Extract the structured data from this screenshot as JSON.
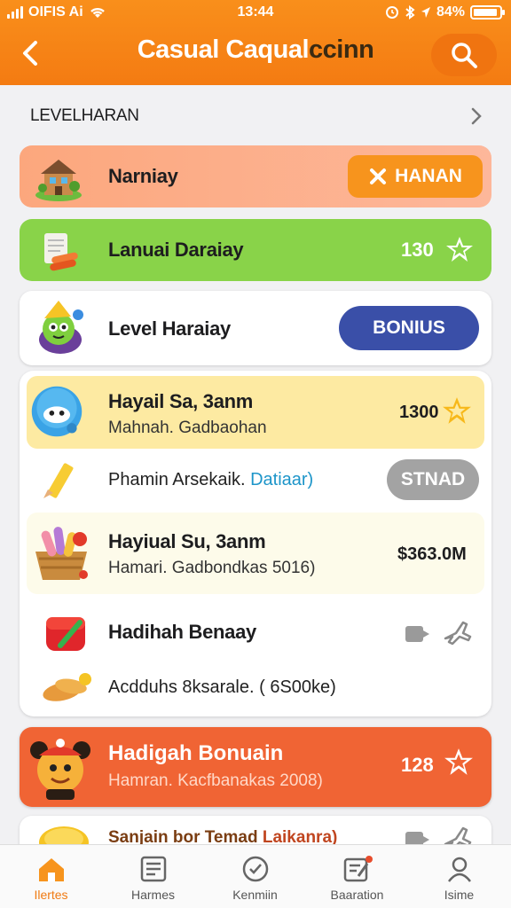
{
  "status_bar": {
    "carrier": "OIFIS Ai",
    "time": "13:44",
    "battery": "84%"
  },
  "header": {
    "title_main": "Casual Caqual",
    "title_tail": "ccinn"
  },
  "level_header": {
    "title": "LEVELHARAN",
    "title_accent": ""
  },
  "cards": [
    {
      "label": "Narniay",
      "button_label": "HANAN",
      "color": "#fca880"
    },
    {
      "label": "Lanuai Daraiay",
      "score": "130",
      "color": "#89d349"
    },
    {
      "label": "Level Haraiay",
      "button_label": "BONIUS",
      "color": "#ffffff"
    }
  ],
  "group": {
    "rows": [
      {
        "title": "Hayail Sa, 3anm",
        "subtitle": "Mahnah. Gadbaohan",
        "value": "1300"
      },
      {
        "subtitle_dark": "Phamin Arsekaik.",
        "subtitle_link": "Datiaar)",
        "button_label": "STNAD"
      },
      {
        "title": "Hayiual Su, 3anm",
        "subtitle": "Hamari. Gadbondkas  5016)",
        "value": "$363.0M"
      },
      {
        "title": "Hadihah Benaay"
      },
      {
        "subtitle": "Acdduhs 8ksarale.  ( 6S00ke)"
      }
    ]
  },
  "bonus_card": {
    "title": "Hadigah Bonuain",
    "subtitle": "Hamran. Kacfbanakas 2008)",
    "score": "128",
    "color": "#f06434"
  },
  "peek_row": {
    "title": "Sanjain bor Temad  ",
    "title_link": "Laikanra)"
  },
  "tabs": [
    {
      "label": "Ilertes"
    },
    {
      "label": "Harmes"
    },
    {
      "label": "Kenmiin"
    },
    {
      "label": "Baaration"
    },
    {
      "label": "Isime"
    }
  ]
}
